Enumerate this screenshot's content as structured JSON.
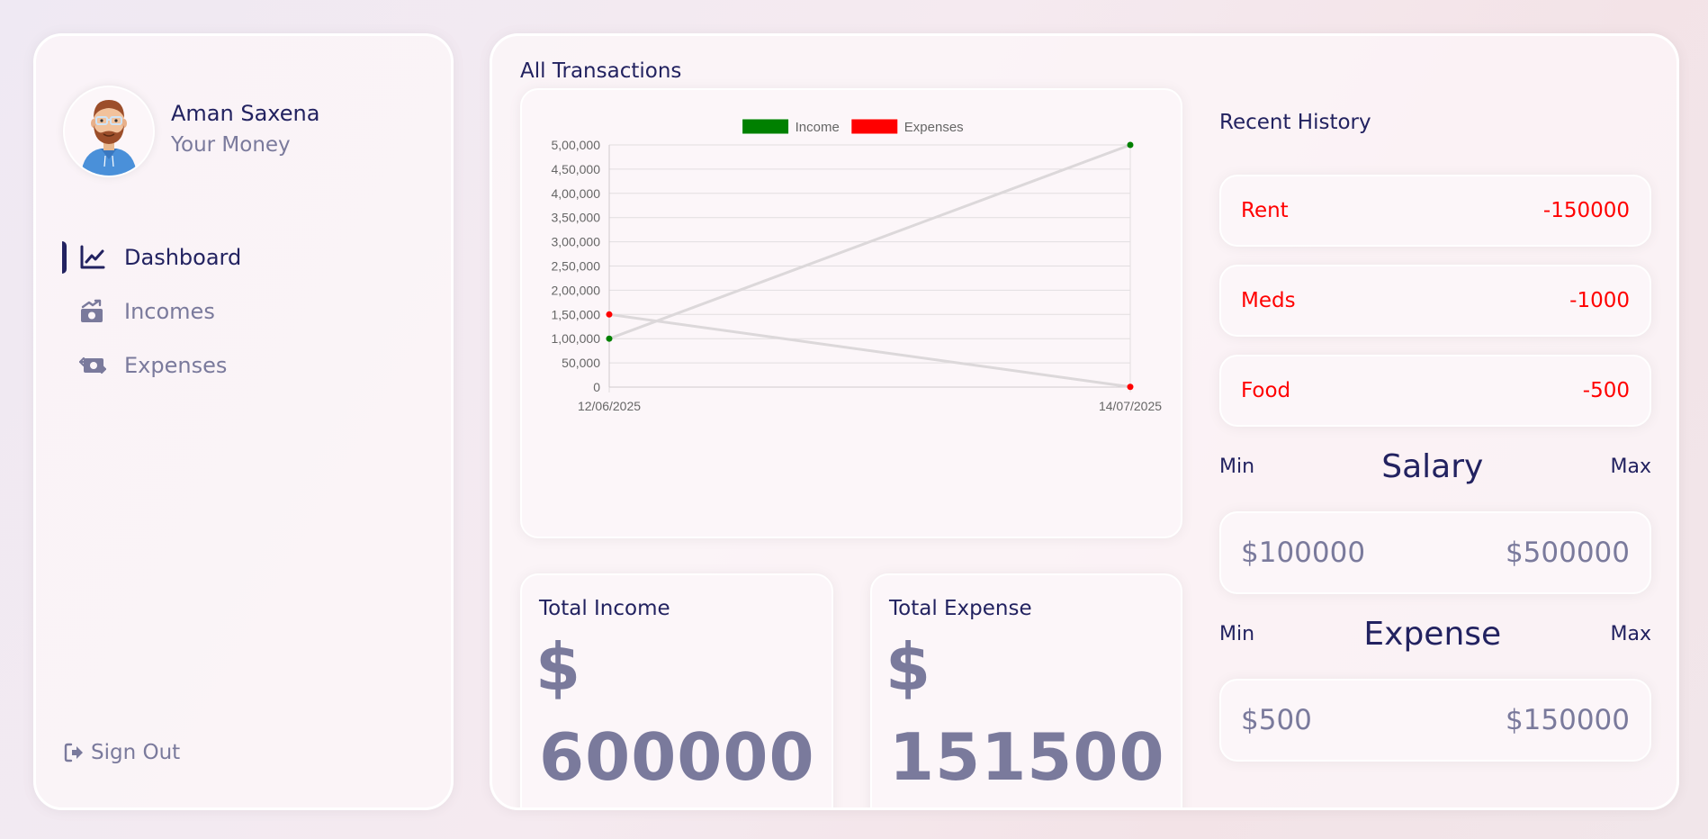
{
  "user": {
    "name": "Aman Saxena",
    "subtitle": "Your Money"
  },
  "nav": {
    "items": [
      {
        "label": "Dashboard",
        "icon": "chart-line-icon",
        "active": true
      },
      {
        "label": "Incomes",
        "icon": "money-bill-trend-up-icon",
        "active": false
      },
      {
        "label": "Expenses",
        "icon": "money-bill-transfer-icon",
        "active": false
      }
    ],
    "signout_label": "Sign Out"
  },
  "main": {
    "title": "All Transactions",
    "total_income": {
      "label": "Total Income",
      "currency": "$",
      "value": "600000"
    },
    "total_expense": {
      "label": "Total Expense",
      "currency": "$",
      "value": "151500"
    }
  },
  "chart_data": {
    "type": "line",
    "x": [
      "12/06/2025",
      "14/07/2025"
    ],
    "series": [
      {
        "name": "Income",
        "values": [
          100000,
          500000
        ],
        "color": "#008000"
      },
      {
        "name": "Expenses",
        "values": [
          150000,
          500
        ],
        "color": "#ff0000"
      }
    ],
    "y_ticks": [
      0,
      50000,
      100000,
      150000,
      200000,
      250000,
      300000,
      350000,
      400000,
      450000,
      500000
    ],
    "y_tick_labels": [
      "0",
      "50,000",
      "1,00,000",
      "1,50,000",
      "2,00,000",
      "2,50,000",
      "3,00,000",
      "3,50,000",
      "4,00,000",
      "4,50,000",
      "5,00,000"
    ],
    "ylim": [
      0,
      500000
    ],
    "legend_position": "top",
    "grid": true,
    "line_color": "#dcd8da"
  },
  "history": {
    "title": "Recent History",
    "items": [
      {
        "name": "Rent",
        "amount": "-150000"
      },
      {
        "name": "Meds",
        "amount": "-1000"
      },
      {
        "name": "Food",
        "amount": "-500"
      }
    ]
  },
  "salary": {
    "min_label": "Min",
    "title": "Salary",
    "max_label": "Max",
    "min_value": "$100000",
    "max_value": "$500000"
  },
  "expense": {
    "min_label": "Min",
    "title": "Expense",
    "max_label": "Max",
    "min_value": "$500",
    "max_value": "$150000"
  },
  "colors": {
    "primary": "#222260",
    "muted": "#7a7a9c",
    "income": "#008000",
    "expense": "#ff0000"
  }
}
